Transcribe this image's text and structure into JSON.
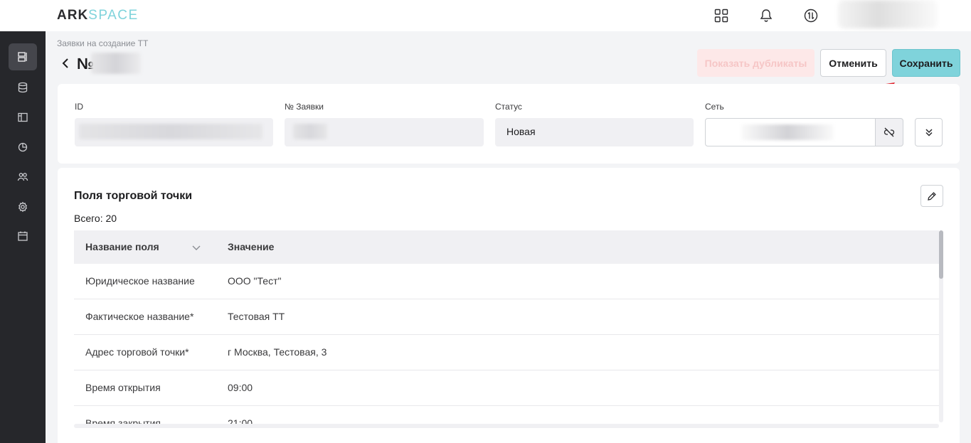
{
  "app": {
    "logo_ark": "ARK",
    "logo_space": "SPACE"
  },
  "header": {
    "breadcrumb": "Заявки на создание ТТ",
    "title": "№",
    "buttons": {
      "show_duplicates": "Показать дубликаты",
      "cancel": "Отменить",
      "save": "Сохранить"
    }
  },
  "info": {
    "fields": [
      {
        "label": "ID",
        "value": ""
      },
      {
        "label": "№ Заявки",
        "value": ""
      },
      {
        "label": "Статус",
        "value": "Новая"
      },
      {
        "label": "Сеть",
        "value": ""
      }
    ]
  },
  "fields_section": {
    "title": "Поля торговой точки",
    "total": "Всего: 20",
    "columns": [
      "Название поля",
      "Значение"
    ],
    "rows": [
      {
        "name": "Юридическое название",
        "value": "ООО \"Тест\""
      },
      {
        "name": "Фактическое название*",
        "value": "Тестовая ТТ"
      },
      {
        "name": "Адрес торговой точки*",
        "value": "г Москва, Тестовая, 3"
      },
      {
        "name": "Время открытия",
        "value": "09:00"
      },
      {
        "name": "Время закрытия",
        "value": "21:00"
      }
    ]
  },
  "colors": {
    "sidebar": "#26272b",
    "accent": "#7fd3db",
    "danger_soft": "#fde8e8",
    "annotation_arrow": "#e0202a"
  }
}
